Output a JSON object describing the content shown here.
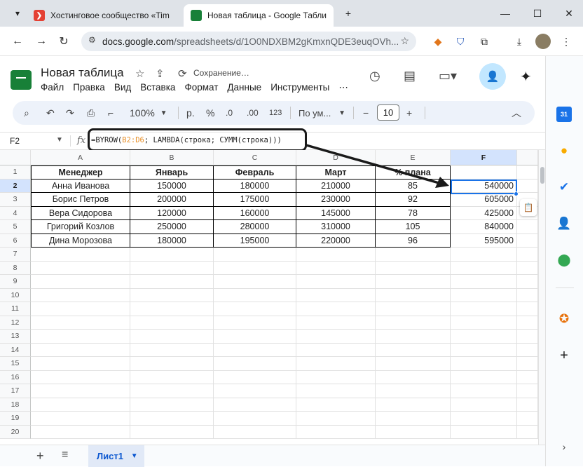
{
  "browser": {
    "tabs": [
      {
        "title": "Хостинговое сообщество «Tim",
        "active": false
      },
      {
        "title": "Новая таблица - Google Табли",
        "active": true
      }
    ],
    "new_tab_label": "+",
    "url_host": "docs.google.com",
    "url_path": "/spreadsheets/d/1O0NDXBM2gKmxnQDE3euqOVh..."
  },
  "app": {
    "title": "Новая таблица",
    "status": "Сохранение…",
    "menu": [
      "Файл",
      "Правка",
      "Вид",
      "Вставка",
      "Формат",
      "Данные",
      "Инструменты"
    ]
  },
  "toolbar": {
    "zoom": "100%",
    "currency": "р.",
    "percent": "%",
    "dec_less": ".0",
    "dec_more": ".00",
    "number_format": "123",
    "font": "По ум...",
    "font_size": "10",
    "minus": "−",
    "plus": "+"
  },
  "formula_bar": {
    "cell_ref": "F2",
    "fx": "fx",
    "formula_pre": "=BYROW(",
    "formula_range": "B2:D6",
    "formula_post": "; LAMBDA(строка; СУММ(строка)))"
  },
  "grid": {
    "columns": [
      "A",
      "B",
      "C",
      "D",
      "E",
      "F"
    ],
    "rows": [
      "1",
      "2",
      "3",
      "4",
      "5",
      "6",
      "7",
      "8",
      "9",
      "10",
      "11",
      "12",
      "13",
      "14",
      "15",
      "16",
      "17",
      "18",
      "19",
      "20"
    ],
    "header": [
      "Менеджер",
      "Январь",
      "Февраль",
      "Март",
      "% плана",
      ""
    ],
    "data": [
      [
        "Анна Иванова",
        "150000",
        "180000",
        "210000",
        "85",
        "540000"
      ],
      [
        "Борис Петров",
        "200000",
        "175000",
        "230000",
        "92",
        "605000"
      ],
      [
        "Вера Сидорова",
        "120000",
        "160000",
        "145000",
        "78",
        "425000"
      ],
      [
        "Григорий Козлов",
        "250000",
        "280000",
        "310000",
        "105",
        "840000"
      ],
      [
        "Дина Морозова",
        "180000",
        "195000",
        "220000",
        "96",
        "595000"
      ]
    ],
    "selected_cell": "F2"
  },
  "sheets": {
    "active": "Лист1"
  },
  "colors": {
    "accent": "#1a73e8",
    "sheets_green": "#188038",
    "formula_ref": "#e8912b"
  }
}
